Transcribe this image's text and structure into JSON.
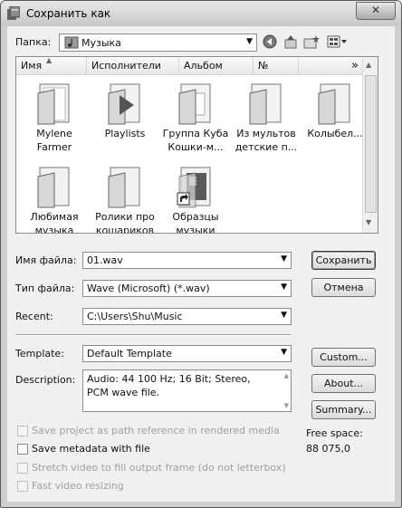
{
  "window": {
    "title": "Сохранить как",
    "close_glyph": "✕"
  },
  "toolbar": {
    "folder_label": "Папка:",
    "folder_value": "Музыка",
    "icons": [
      "back-icon",
      "up-folder-icon",
      "new-folder-icon",
      "view-menu-icon"
    ]
  },
  "file_list": {
    "columns": [
      "Имя",
      "Исполнители",
      "Альбом",
      "№"
    ],
    "more_glyph": "»",
    "items": [
      {
        "line1": "Mylene",
        "line2": "Farmer",
        "icon": "folder-icon"
      },
      {
        "line1": "Playlists",
        "line2": "",
        "icon": "playlist-folder-icon"
      },
      {
        "line1": "Группа Куба",
        "line2": "Кошки-м...",
        "icon": "folder-icon"
      },
      {
        "line1": "Из мультов",
        "line2": "детские п...",
        "icon": "folder-icon"
      },
      {
        "line1": "Колыбел...",
        "line2": "",
        "icon": "folder-icon"
      },
      {
        "line1": "Любимая",
        "line2": "музыка",
        "icon": "folder-icon"
      },
      {
        "line1": "Ролики про",
        "line2": "кошариков",
        "icon": "folder-icon"
      },
      {
        "line1": "Образцы",
        "line2": "музыки",
        "icon": "shortcut-folder-icon"
      }
    ]
  },
  "form": {
    "filename_label": "Имя файла:",
    "filename_value": "01.wav",
    "filetype_label": "Тип файла:",
    "filetype_value": "Wave (Microsoft) (*.wav)",
    "recent_label": "Recent:",
    "recent_value": "C:\\Users\\Shu\\Music",
    "template_label": "Template:",
    "template_value": "Default Template",
    "description_label": "Description:",
    "description_text": "Audio: 44 100 Hz; 16 Bit; Stereo, PCM wave file."
  },
  "buttons": {
    "save": "Сохранить",
    "cancel": "Отмена",
    "custom": "Custom...",
    "about": "About...",
    "summary": "Summary..."
  },
  "options": {
    "save_project": "Save project as path reference in rendered media",
    "save_metadata": "Save metadata with file",
    "stretch_video": "Stretch video to fill output frame (do not letterbox)",
    "fast_resizing": "Fast video resizing"
  },
  "free_space": {
    "label": "Free space:",
    "value": "88 075,0"
  }
}
